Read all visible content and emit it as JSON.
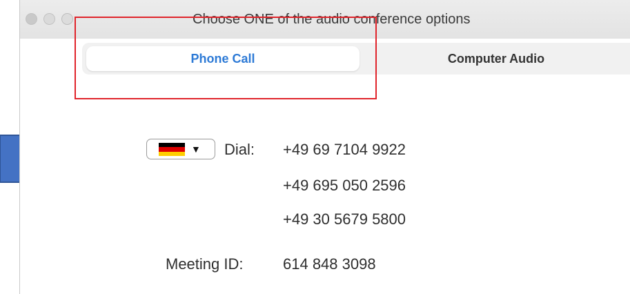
{
  "window": {
    "title": "Choose ONE of the audio conference options"
  },
  "tabs": [
    {
      "label": "Phone Call",
      "active": true
    },
    {
      "label": "Computer Audio",
      "active": false
    }
  ],
  "dial": {
    "label": "Dial:",
    "country_flag": "flag-germany-icon",
    "numbers": [
      "+49 69 7104 9922",
      "+49 695 050 2596",
      "+49 30 5679 5800"
    ]
  },
  "meeting": {
    "label": "Meeting ID:",
    "id": "614 848 3098"
  },
  "colors": {
    "accent": "#2d7ad6",
    "highlight_box": "#e0232a",
    "arrow_fill": "#4472c4",
    "arrow_stroke": "#2f5597"
  }
}
